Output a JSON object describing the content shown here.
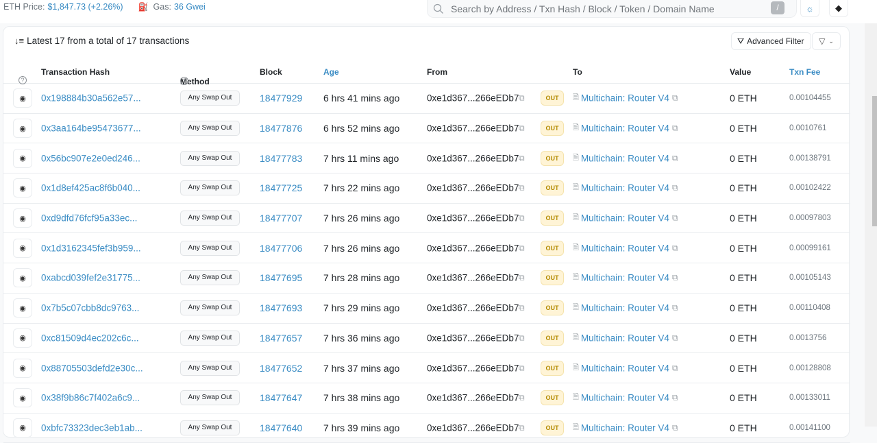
{
  "topbar": {
    "eth_price_label": "ETH Price:",
    "eth_price_value": "$1,847.73 (+2.26%)",
    "gas_label": "Gas:",
    "gas_value": "36 Gwei",
    "search_placeholder": "Search by Address / Txn Hash / Block / Token / Domain Name",
    "search_value": "",
    "search_shortcut": "/",
    "icons": [
      "search-icon",
      "gas-pump-icon",
      "sun-icon",
      "ethereum-icon"
    ]
  },
  "panel": {
    "summary": "Latest 17 from a total of 17 transactions",
    "advanced_filter_label": "Advanced Filter",
    "filter_dropdown_icon": "filter-icon"
  },
  "table": {
    "columns": [
      "",
      "Transaction Hash",
      "Method",
      "Block",
      "Age",
      "From",
      "",
      "To",
      "Value",
      "Txn Fee"
    ],
    "rows": [
      {
        "hash": "0x198884b30a562e57...",
        "method": "Any Swap Out",
        "block": "18477929",
        "age": "6 hrs 41 mins ago",
        "from": "0xe1d367...266eEDb7",
        "direction": "OUT",
        "to": "Multichain: Router V4",
        "value": "0 ETH",
        "fee": "0.00104455"
      },
      {
        "hash": "0x3aa164be95473677...",
        "method": "Any Swap Out",
        "block": "18477876",
        "age": "6 hrs 52 mins ago",
        "from": "0xe1d367...266eEDb7",
        "direction": "OUT",
        "to": "Multichain: Router V4",
        "value": "0 ETH",
        "fee": "0.0010761"
      },
      {
        "hash": "0x56bc907e2e0ed246...",
        "method": "Any Swap Out",
        "block": "18477783",
        "age": "7 hrs 11 mins ago",
        "from": "0xe1d367...266eEDb7",
        "direction": "OUT",
        "to": "Multichain: Router V4",
        "value": "0 ETH",
        "fee": "0.00138791"
      },
      {
        "hash": "0x1d8ef425ac8f6b040...",
        "method": "Any Swap Out",
        "block": "18477725",
        "age": "7 hrs 22 mins ago",
        "from": "0xe1d367...266eEDb7",
        "direction": "OUT",
        "to": "Multichain: Router V4",
        "value": "0 ETH",
        "fee": "0.00102422"
      },
      {
        "hash": "0xd9dfd76fcf95a33ec...",
        "method": "Any Swap Out",
        "block": "18477707",
        "age": "7 hrs 26 mins ago",
        "from": "0xe1d367...266eEDb7",
        "direction": "OUT",
        "to": "Multichain: Router V4",
        "value": "0 ETH",
        "fee": "0.00097803"
      },
      {
        "hash": "0x1d3162345fef3b959...",
        "method": "Any Swap Out",
        "block": "18477706",
        "age": "7 hrs 26 mins ago",
        "from": "0xe1d367...266eEDb7",
        "direction": "OUT",
        "to": "Multichain: Router V4",
        "value": "0 ETH",
        "fee": "0.00099161"
      },
      {
        "hash": "0xabcd039fef2e31775...",
        "method": "Any Swap Out",
        "block": "18477695",
        "age": "7 hrs 28 mins ago",
        "from": "0xe1d367...266eEDb7",
        "direction": "OUT",
        "to": "Multichain: Router V4",
        "value": "0 ETH",
        "fee": "0.00105143"
      },
      {
        "hash": "0x7b5c07cbb8dc9763...",
        "method": "Any Swap Out",
        "block": "18477693",
        "age": "7 hrs 29 mins ago",
        "from": "0xe1d367...266eEDb7",
        "direction": "OUT",
        "to": "Multichain: Router V4",
        "value": "0 ETH",
        "fee": "0.00110408"
      },
      {
        "hash": "0xc81509d4ec202c6c...",
        "method": "Any Swap Out",
        "block": "18477657",
        "age": "7 hrs 36 mins ago",
        "from": "0xe1d367...266eEDb7",
        "direction": "OUT",
        "to": "Multichain: Router V4",
        "value": "0 ETH",
        "fee": "0.0013756"
      },
      {
        "hash": "0x88705503defd2e30c...",
        "method": "Any Swap Out",
        "block": "18477652",
        "age": "7 hrs 37 mins ago",
        "from": "0xe1d367...266eEDb7",
        "direction": "OUT",
        "to": "Multichain: Router V4",
        "value": "0 ETH",
        "fee": "0.00128808"
      },
      {
        "hash": "0x38f9b86c7f402a6c9...",
        "method": "Any Swap Out",
        "block": "18477647",
        "age": "7 hrs 38 mins ago",
        "from": "0xe1d367...266eEDb7",
        "direction": "OUT",
        "to": "Multichain: Router V4",
        "value": "0 ETH",
        "fee": "0.00133011"
      },
      {
        "hash": "0xbfc73323dec3eb1ab...",
        "method": "Any Swap Out",
        "block": "18477640",
        "age": "7 hrs 39 mins ago",
        "from": "0xe1d367...266eEDb7",
        "direction": "OUT",
        "to": "Multichain: Router V4",
        "value": "0 ETH",
        "fee": "0.00141100"
      }
    ]
  },
  "colors": {
    "link": "#3a8cc4",
    "out_badge_bg": "#fff4d6",
    "out_badge_text": "#b48a00"
  }
}
